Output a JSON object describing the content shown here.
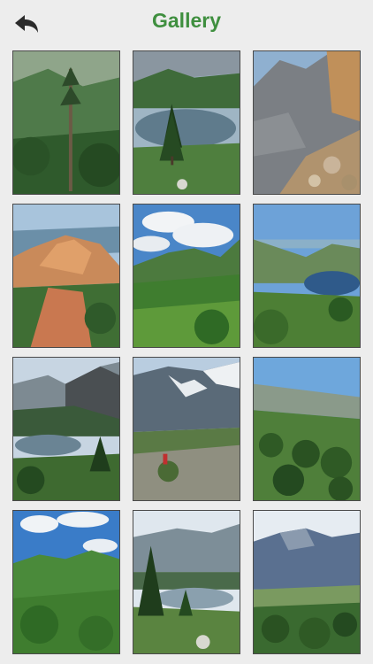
{
  "header": {
    "title": "Gallery",
    "back_icon": "back-arrow-icon"
  },
  "gallery": {
    "items": [
      {
        "scene": "forest-tree"
      },
      {
        "scene": "lake-pine"
      },
      {
        "scene": "rock-cliff"
      },
      {
        "scene": "red-rock-formation"
      },
      {
        "scene": "green-valley-clouds"
      },
      {
        "scene": "mountain-lake-valley"
      },
      {
        "scene": "lake-ridge-forest"
      },
      {
        "scene": "snowy-peaks-hiker"
      },
      {
        "scene": "green-slope-pines"
      },
      {
        "scene": "green-hills-clouds"
      },
      {
        "scene": "lake-pine-mountain"
      },
      {
        "scene": "rocky-ridge-shrubs"
      }
    ]
  },
  "colors": {
    "accent": "#3f8f3f",
    "background": "#ededed"
  }
}
